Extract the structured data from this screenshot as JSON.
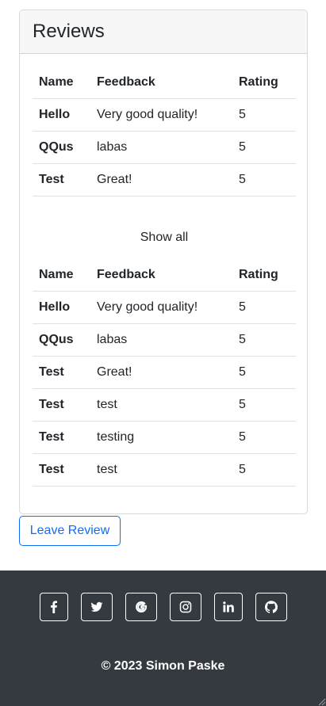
{
  "reviews": {
    "title": "Reviews",
    "columns": {
      "name": "Name",
      "feedback": "Feedback",
      "rating": "Rating"
    },
    "preview_rows": [
      {
        "name": "Hello",
        "feedback": "Very good quality!",
        "rating": "5"
      },
      {
        "name": "QQus",
        "feedback": "labas",
        "rating": "5"
      },
      {
        "name": "Test",
        "feedback": "Great!",
        "rating": "5"
      }
    ],
    "show_all_label": "Show all",
    "all_rows": [
      {
        "name": "Hello",
        "feedback": "Very good quality!",
        "rating": "5"
      },
      {
        "name": "QQus",
        "feedback": "labas",
        "rating": "5"
      },
      {
        "name": "Test",
        "feedback": "Great!",
        "rating": "5"
      },
      {
        "name": "Test",
        "feedback": "test",
        "rating": "5"
      },
      {
        "name": "Test",
        "feedback": "testing",
        "rating": "5"
      },
      {
        "name": "Test",
        "feedback": "test",
        "rating": "5"
      }
    ]
  },
  "leave_review_label": "Leave Review",
  "footer": {
    "social_icons": [
      "facebook-icon",
      "twitter-icon",
      "google-icon",
      "instagram-icon",
      "linkedin-icon",
      "github-icon"
    ],
    "copyright": "© 2023 Simon Paske"
  },
  "colors": {
    "accent": "#0d6efd",
    "footer_bg": "#343a40",
    "card_header_bg": "#f7f7f7"
  }
}
